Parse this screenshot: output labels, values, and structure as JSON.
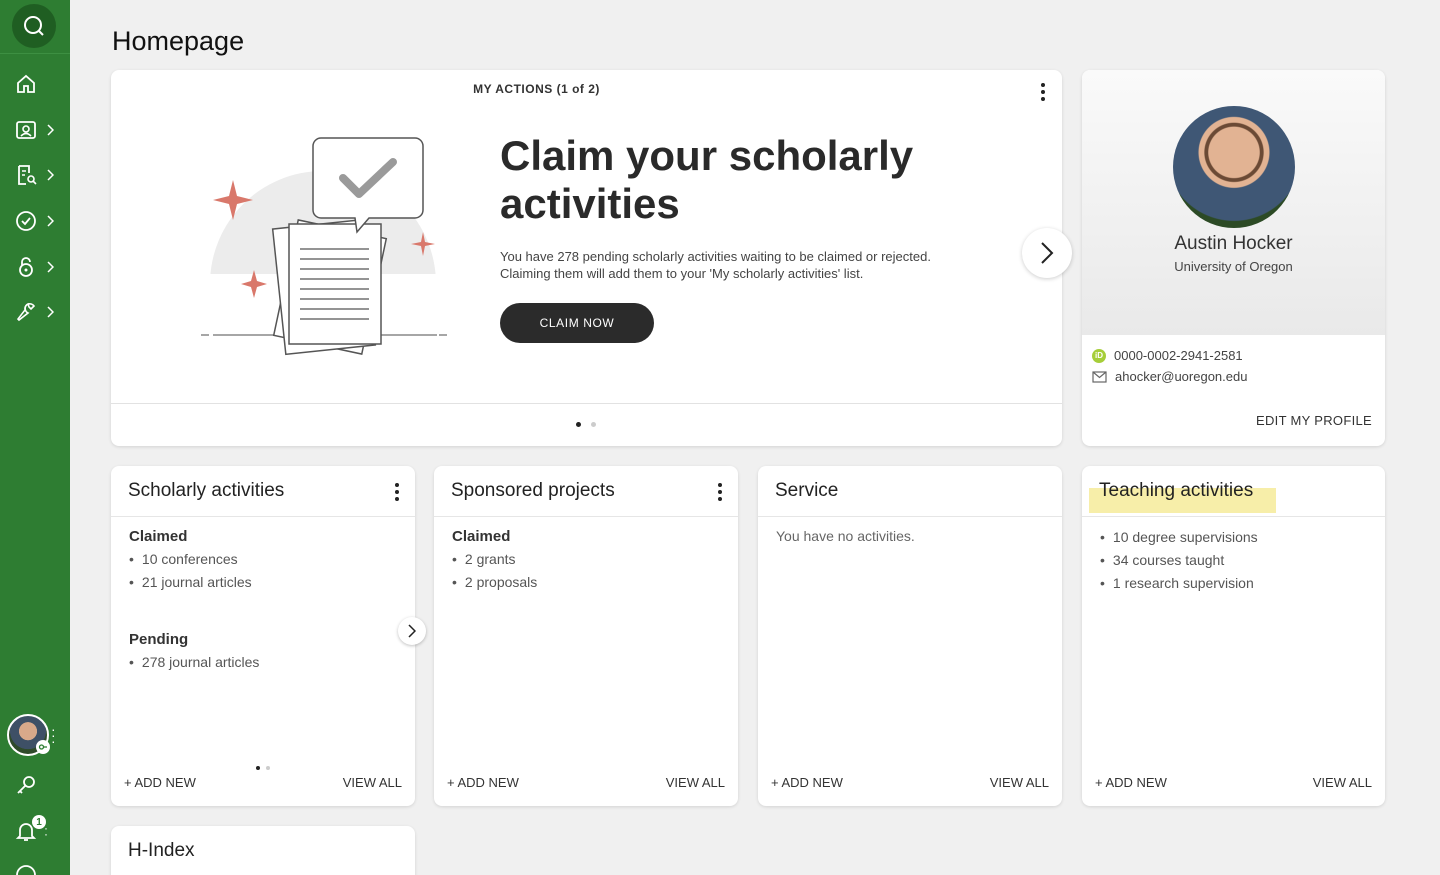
{
  "page": {
    "title": "Homepage"
  },
  "sidebar": {
    "items": [
      {
        "icon": "home-icon"
      },
      {
        "icon": "profile-icon"
      },
      {
        "icon": "search-document-icon"
      },
      {
        "icon": "verified-icon"
      },
      {
        "icon": "lock-icon"
      },
      {
        "icon": "wrench-icon"
      }
    ],
    "notification_count": "1"
  },
  "actions": {
    "label": "MY ACTIONS (1 of 2)",
    "title": "Claim your scholarly activities",
    "description": "You have 278 pending scholarly activities waiting to be claimed or rejected. Claiming them will add them to your 'My scholarly activities' list.",
    "button": "CLAIM NOW"
  },
  "profile": {
    "name": "Austin Hocker",
    "university": "University of Oregon",
    "orcid": "0000-0002-2941-2581",
    "email": "ahocker@uoregon.edu",
    "edit_label": "EDIT MY PROFILE"
  },
  "cards": {
    "scholarly": {
      "title": "Scholarly activities",
      "claimed_label": "Claimed",
      "claimed": [
        "10 conferences",
        "21 journal articles"
      ],
      "pending_label": "Pending",
      "pending": [
        "278 journal articles"
      ]
    },
    "sponsored": {
      "title": "Sponsored projects",
      "claimed_label": "Claimed",
      "claimed": [
        "2 grants",
        "2 proposals"
      ]
    },
    "service": {
      "title": "Service",
      "empty": "You have no activities."
    },
    "teaching": {
      "title": "Teaching activities",
      "items": [
        "10 degree supervisions",
        "34 courses taught",
        "1 research supervision"
      ]
    },
    "hindex": {
      "title": "H-Index"
    },
    "add_new": "+ ADD NEW",
    "view_all": "VIEW ALL"
  },
  "colors": {
    "sidebar": "#2e7d32",
    "accent_star": "#d9786b",
    "highlight": "#f6eb9a"
  }
}
